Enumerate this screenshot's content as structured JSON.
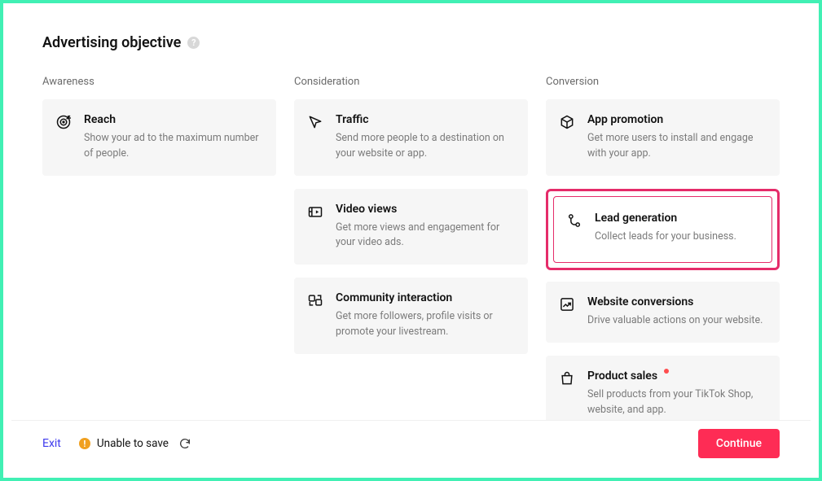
{
  "page_title": "Advertising objective",
  "columns": {
    "awareness": {
      "header": "Awareness"
    },
    "consideration": {
      "header": "Consideration"
    },
    "conversion": {
      "header": "Conversion"
    }
  },
  "cards": {
    "reach": {
      "title": "Reach",
      "desc": "Show your ad to the maximum number of people."
    },
    "traffic": {
      "title": "Traffic",
      "desc": "Send more people to a destination on your website or app."
    },
    "video_views": {
      "title": "Video views",
      "desc": "Get more views and engagement for your video ads."
    },
    "community": {
      "title": "Community interaction",
      "desc": "Get more followers, profile visits or promote your livestream."
    },
    "app_promo": {
      "title": "App promotion",
      "desc": "Get more users to install and engage with your app."
    },
    "lead_gen": {
      "title": "Lead generation",
      "desc": "Collect leads for your business."
    },
    "web_conv": {
      "title": "Website conversions",
      "desc": "Drive valuable actions on your website."
    },
    "product_sales": {
      "title": "Product sales",
      "desc": "Sell products from your TikTok Shop, website, and app."
    }
  },
  "footer": {
    "exit": "Exit",
    "status": "Unable to save",
    "continue": "Continue"
  }
}
